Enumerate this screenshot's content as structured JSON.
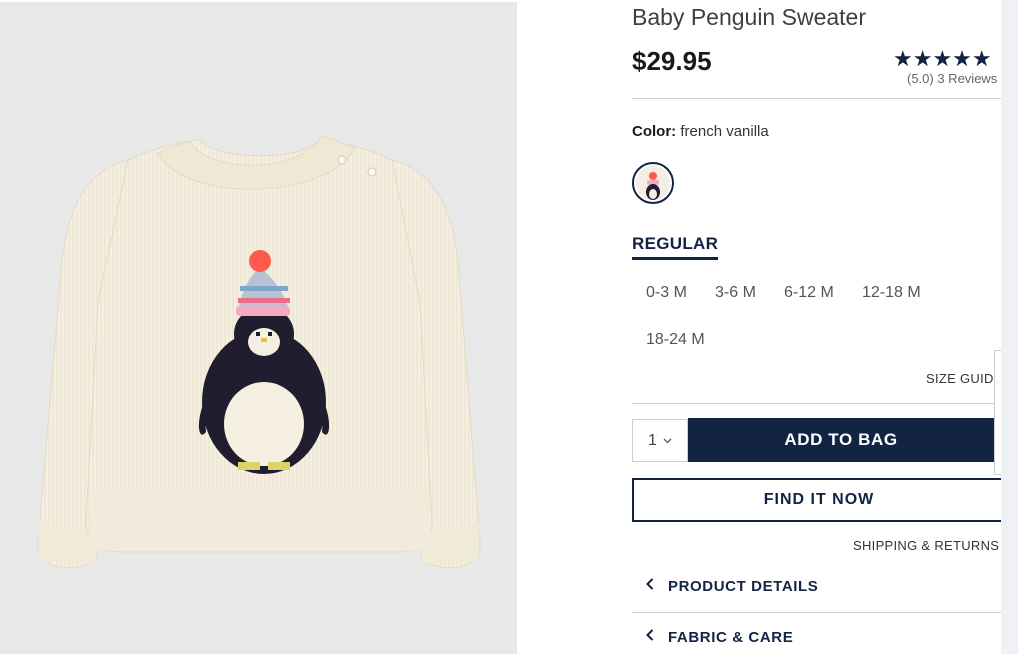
{
  "product": {
    "title": "Baby Penguin Sweater",
    "price": "$29.95",
    "rating_stars": "★★★★★",
    "rating_text": "(5.0) 3 Reviews",
    "rating_value": 5.0
  },
  "color": {
    "label": "Color:",
    "value": "french vanilla"
  },
  "fit": {
    "tab": "REGULAR"
  },
  "sizes": [
    "0-3 M",
    "3-6 M",
    "6-12 M",
    "12-18 M",
    "18-24 M"
  ],
  "size_guide": "SIZE GUID",
  "quantity": {
    "value": "1"
  },
  "actions": {
    "add_to_bag": "ADD TO BAG",
    "find_it_now": "FIND IT NOW",
    "shipping_returns": "SHIPPING & RETURNS"
  },
  "accordions": [
    "PRODUCT DETAILS",
    "FABRIC & CARE"
  ],
  "colors": {
    "navy": "#122344",
    "image_bg": "#e8e8e8",
    "sweater": "#f4efe0"
  }
}
